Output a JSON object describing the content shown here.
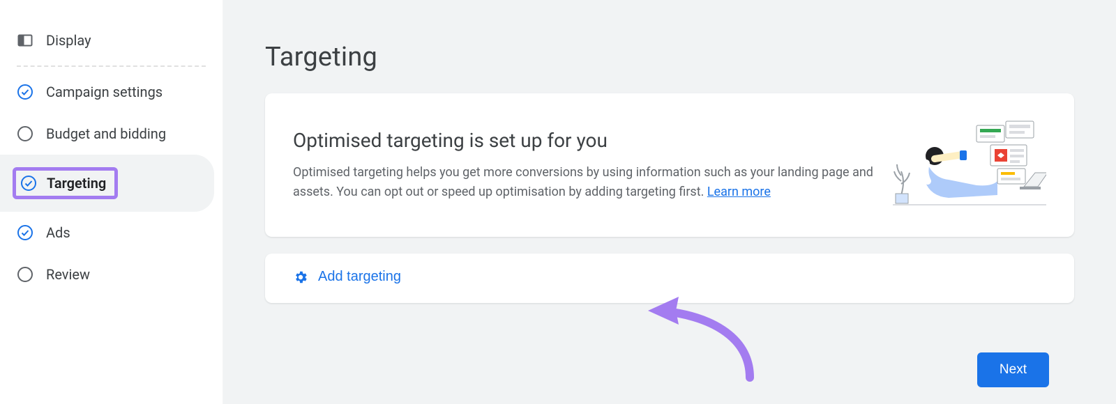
{
  "sidebar": {
    "items": [
      {
        "label": "Display",
        "state": "header"
      },
      {
        "label": "Campaign settings",
        "state": "done"
      },
      {
        "label": "Budget and bidding",
        "state": "pending"
      },
      {
        "label": "Targeting",
        "state": "active-done"
      },
      {
        "label": "Ads",
        "state": "done"
      },
      {
        "label": "Review",
        "state": "pending"
      }
    ]
  },
  "main": {
    "title": "Targeting",
    "info": {
      "heading": "Optimised targeting is set up for you",
      "body": "Optimised targeting helps you get more conversions by using information such as your landing page and assets. You can opt out or speed up optimisation by adding targeting first. ",
      "learn_more": "Learn more"
    },
    "add_targeting_label": "Add targeting",
    "next_label": "Next"
  }
}
